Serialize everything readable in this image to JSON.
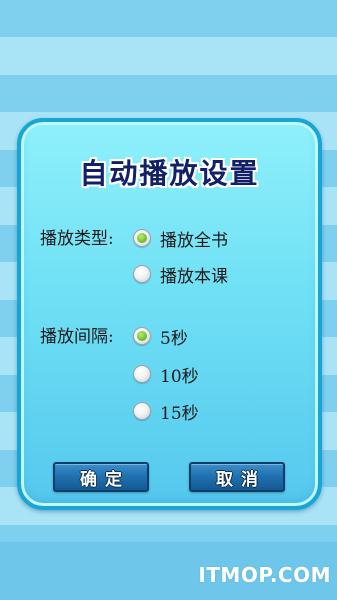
{
  "dialog": {
    "title": "自动播放设置",
    "play_type": {
      "label": "播放类型:",
      "options": [
        {
          "label": "播放全书",
          "checked": true
        },
        {
          "label": "播放本课",
          "checked": false
        }
      ]
    },
    "interval": {
      "label": "播放间隔:",
      "options": [
        {
          "label": "5秒",
          "checked": true
        },
        {
          "label": "10秒",
          "checked": false
        },
        {
          "label": "15秒",
          "checked": false
        }
      ]
    },
    "confirm_label": "确定",
    "cancel_label": "取消"
  },
  "watermark": "ITMOP.COM",
  "colors": {
    "stripe_dark": "#7fd0ee",
    "stripe_light": "#a9e3f6",
    "dialog_border": "#17a6d6",
    "title": "#12206a",
    "button": "#1f6fae",
    "radio_selected": "#72c02a"
  }
}
